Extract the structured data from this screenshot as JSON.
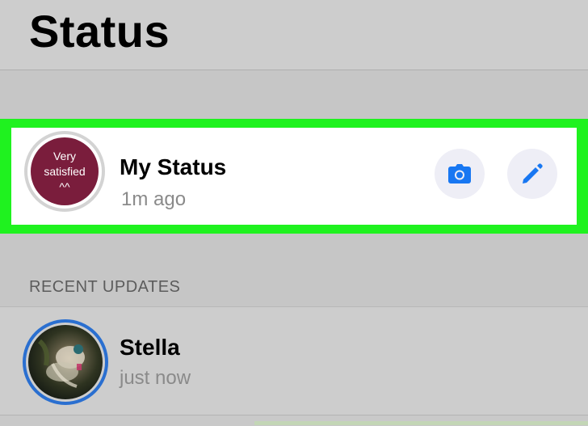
{
  "header": {
    "title": "Status"
  },
  "my_status": {
    "avatar_text": [
      "Very",
      "satisfied",
      "^^"
    ],
    "avatar_color": "#7a1d3c",
    "name": "My Status",
    "time": "1m ago",
    "highlight_color": "#1ff21f",
    "camera_icon": "camera-icon",
    "edit_icon": "pencil-icon"
  },
  "recent": {
    "label": "RECENT UPDATES",
    "items": [
      {
        "name": "Stella",
        "time": "just now",
        "ring_color": "#2a6fd0"
      }
    ]
  },
  "accent_color": "#1877f2"
}
